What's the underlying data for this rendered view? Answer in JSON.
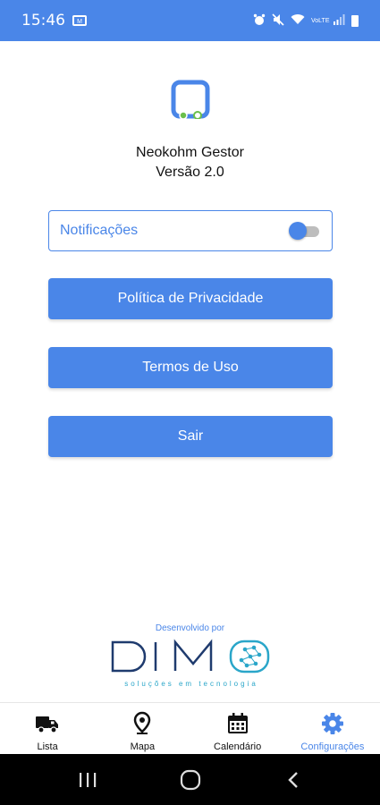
{
  "status_bar": {
    "time": "15:46",
    "left_icon_text": "M",
    "network_text": "VoLTE"
  },
  "app": {
    "name": "Neokohm Gestor",
    "version": "Versão 2.0"
  },
  "settings": {
    "notifications_label": "Notificações",
    "notifications_enabled": true,
    "privacy_label": "Política de Privacidade",
    "terms_label": "Termos de Uso",
    "exit_label": "Sair"
  },
  "footer": {
    "developed_by": "Desenvolvido por"
  },
  "bottom_nav": {
    "items": [
      {
        "label": "Lista",
        "icon": "truck-icon"
      },
      {
        "label": "Mapa",
        "icon": "map-pin-icon"
      },
      {
        "label": "Calendário",
        "icon": "calendar-icon"
      },
      {
        "label": "Configurações",
        "icon": "gear-icon"
      }
    ],
    "active_index": 3
  },
  "colors": {
    "accent": "#4a86e8",
    "status_bar": "#4a86e8",
    "text": "#111111"
  }
}
